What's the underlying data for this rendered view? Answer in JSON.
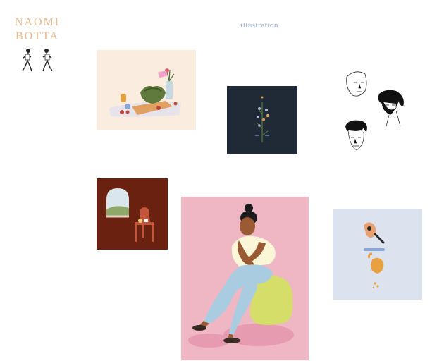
{
  "site": {
    "logo_line1": "NAOMI",
    "logo_line2": "BOTTA"
  },
  "nav": {
    "illustration_label": "illustration"
  },
  "colors": {
    "logo": "#e8b98c",
    "nav_link": "#8aa2c6",
    "background": "#ffffff"
  },
  "gallery": {
    "items": [
      {
        "icon": "still-life-table-illustration"
      },
      {
        "icon": "dark-flower-illustration"
      },
      {
        "icon": "portrait-sketches-illustration"
      },
      {
        "icon": "room-with-chair-illustration"
      },
      {
        "icon": "seated-woman-illustration"
      },
      {
        "icon": "food-objects-illustration"
      }
    ]
  }
}
